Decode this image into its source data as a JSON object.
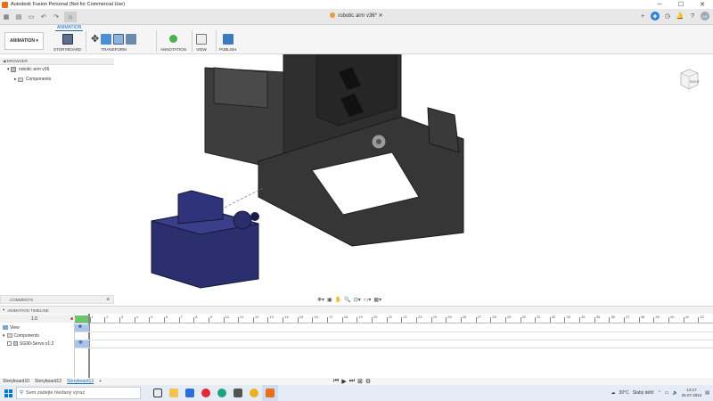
{
  "window": {
    "title": "Autodesk Fusion Personal (Not for Commercial Use)",
    "controls": [
      "minimize",
      "maximize",
      "close"
    ]
  },
  "tabbar": {
    "document_tab": "robotic arm v36*",
    "icons": [
      "app-menu-icon",
      "save-icon",
      "undo-icon",
      "redo-icon",
      "home-icon"
    ],
    "right_icons": [
      "new-tab-icon",
      "extensions-icon",
      "job-status-icon",
      "notifications-icon",
      "help-icon",
      "user-avatar"
    ]
  },
  "toolbar": {
    "workspace_tab": "ANIMATION",
    "workspace": "ANIMATION",
    "groups": [
      {
        "label": "STORYBOARD",
        "id": "storyboard"
      },
      {
        "label": "TRANSFORM",
        "id": "transform"
      },
      {
        "label": "ANNOTATION",
        "id": "annotation"
      },
      {
        "label": "VIEW",
        "id": "view"
      },
      {
        "label": "PUBLISH",
        "id": "publish"
      }
    ]
  },
  "browser": {
    "header": "BROWSER",
    "root": "robotic arm v36",
    "components": "Components"
  },
  "comments": {
    "label": "COMMENTS"
  },
  "viewcube": {
    "label": "RIGHT"
  },
  "timeline": {
    "header": "ANIMATION TIMELINE",
    "time_value": "1.0",
    "rows": [
      {
        "label": "View"
      },
      {
        "label": "Components"
      },
      {
        "label": "SG90-Servo v1:2"
      }
    ],
    "ruler_labels": [
      "0",
      "1",
      "2",
      "3",
      "4",
      "5",
      "6",
      "7",
      "8",
      "9",
      "10",
      "11",
      "12",
      "13",
      "14",
      "15",
      "16",
      "17",
      "18",
      "19",
      "20",
      "21",
      "22",
      "23",
      "24",
      "25",
      "26",
      "27",
      "28",
      "29",
      "30",
      "31",
      "32",
      "33",
      "34",
      "35",
      "36",
      "37",
      "38",
      "39",
      "40",
      "41",
      "42"
    ]
  },
  "storyboards": {
    "tabs": [
      "Storyboard10",
      "Storyboard12",
      "Storyboard13"
    ],
    "active": "Storyboard13",
    "add": "+"
  },
  "taskbar": {
    "search_placeholder": "Sem zadejte hledaný výraz",
    "weather_temp": "30°C",
    "weather_text": "Slabý déšť",
    "time": "13:17",
    "date": "25.07.2024",
    "colors": {
      "accent": "#e86e1a",
      "taskbar": "#e6ecf5"
    }
  }
}
